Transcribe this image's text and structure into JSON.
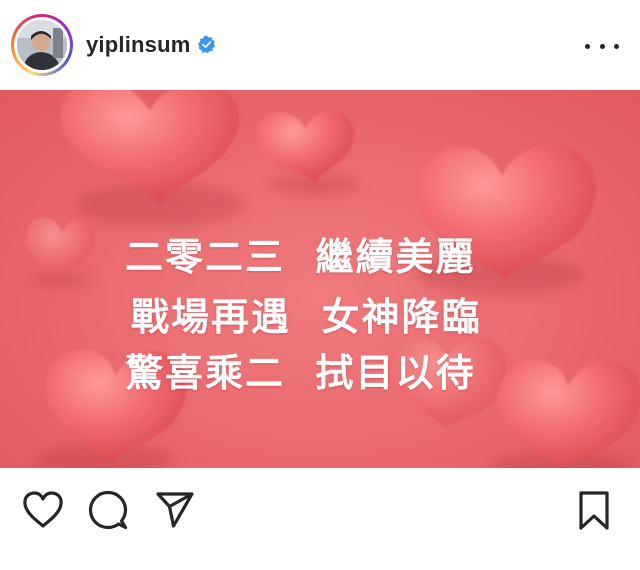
{
  "header": {
    "username": "yiplinsum",
    "verified": true,
    "verified_color": "#3897f0"
  },
  "image": {
    "background_color": "#ea6c70",
    "caption_lines": [
      "二零二三  繼續美麗",
      "戰場再遇  女神降臨",
      "驚喜乘二  拭目以待"
    ]
  },
  "actions": {
    "icons": [
      "heart-icon",
      "comment-icon",
      "share-icon",
      "bookmark-icon"
    ],
    "icon_color": "#262626"
  }
}
